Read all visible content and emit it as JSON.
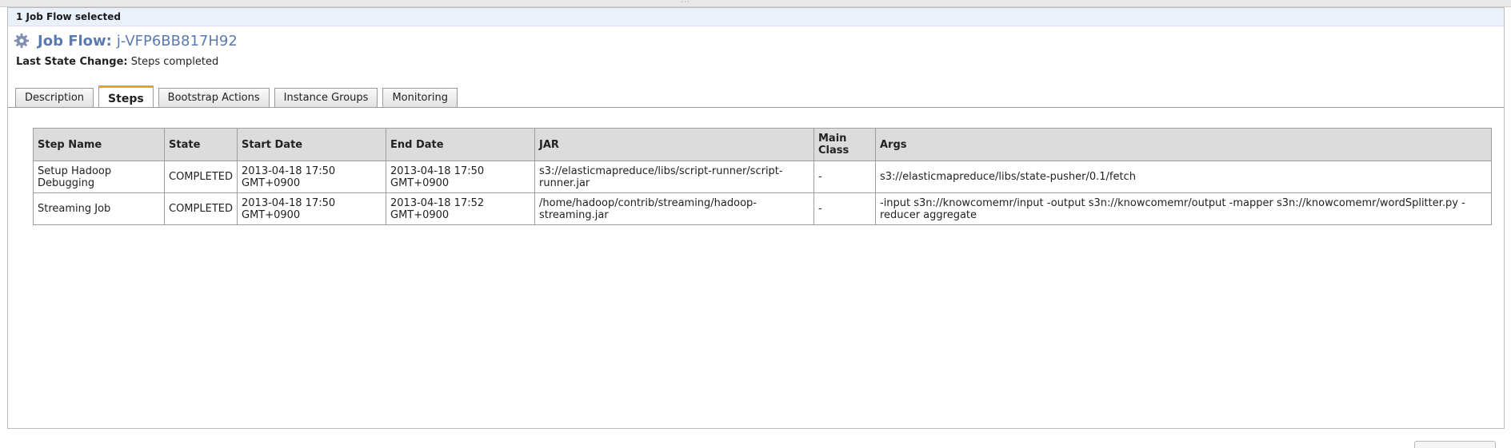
{
  "selection": {
    "text": "1 Job Flow selected"
  },
  "header": {
    "icon": "gear-icon",
    "title_label": "Job Flow:",
    "title_value": "j-VFP6BB817H92"
  },
  "state": {
    "label": "Last State Change:",
    "value": "Steps completed"
  },
  "tabs": [
    {
      "label": "Description",
      "active": false
    },
    {
      "label": "Steps",
      "active": true
    },
    {
      "label": "Bootstrap Actions",
      "active": false
    },
    {
      "label": "Instance Groups",
      "active": false
    },
    {
      "label": "Monitoring",
      "active": false
    }
  ],
  "table": {
    "columns": [
      "Step Name",
      "State",
      "Start Date",
      "End Date",
      "JAR",
      "Main Class",
      "Args"
    ],
    "rows": [
      {
        "name": "Setup Hadoop Debugging",
        "state": "COMPLETED",
        "start": "2013-04-18 17:50 GMT+0900",
        "end": "2013-04-18 17:50 GMT+0900",
        "jar": "s3://elasticmapreduce/libs/script-runner/script-runner.jar",
        "main_class": "-",
        "args": "s3://elasticmapreduce/libs/state-pusher/0.1/fetch"
      },
      {
        "name": "Streaming Job",
        "state": "COMPLETED",
        "start": "2013-04-18 17:50 GMT+0900",
        "end": "2013-04-18 17:52 GMT+0900",
        "jar": "/home/hadoop/contrib/streaming/hadoop-streaming.jar",
        "main_class": "-",
        "args": "-input s3n://knowcomemr/input -output s3n://knowcomemr/output -mapper s3n://knowcomemr/wordSplitter.py -reducer aggregate"
      }
    ]
  },
  "colors": {
    "title": "#5a7ab0",
    "selection_bar": "#ebf1fb",
    "active_tab_accent": "#f0a020",
    "table_header": "#dcdcdc"
  }
}
